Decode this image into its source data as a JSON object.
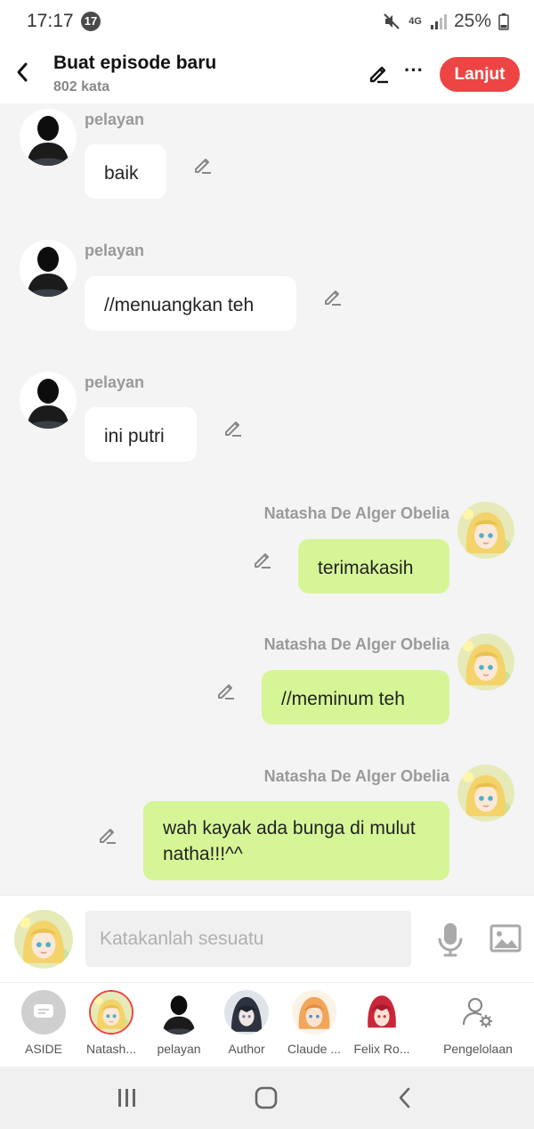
{
  "status": {
    "time": "17:17",
    "notif_count": "17",
    "network": "4G",
    "battery": "25%"
  },
  "header": {
    "title": "Buat episode baru",
    "subtitle": "802 kata",
    "next_label": "Lanjut"
  },
  "messages": [
    {
      "sender": "pelayan",
      "text": "baik",
      "side": "left"
    },
    {
      "sender": "pelayan",
      "text": "//menuangkan teh",
      "side": "left"
    },
    {
      "sender": "pelayan",
      "text": "ini putri",
      "side": "left"
    },
    {
      "sender": "Natasha De Alger Obelia",
      "text": "terimakasih",
      "side": "right"
    },
    {
      "sender": "Natasha De Alger Obelia",
      "text": "//meminum teh",
      "side": "right"
    },
    {
      "sender": "Natasha De Alger Obelia",
      "text": "wah kayak ada bunga di mulut natha!!!^^",
      "side": "right"
    }
  ],
  "input": {
    "placeholder": "Katakanlah sesuatu"
  },
  "characters": [
    {
      "label": "ASIDE"
    },
    {
      "label": "Natash..."
    },
    {
      "label": "pelayan"
    },
    {
      "label": "Author"
    },
    {
      "label": "Claude ..."
    },
    {
      "label": "Felix Ro..."
    },
    {
      "label": "Pengelolaan"
    }
  ],
  "colors": {
    "accent": "#ee4444",
    "right_bubble": "#d6f597",
    "left_bubble": "#ffffff"
  }
}
